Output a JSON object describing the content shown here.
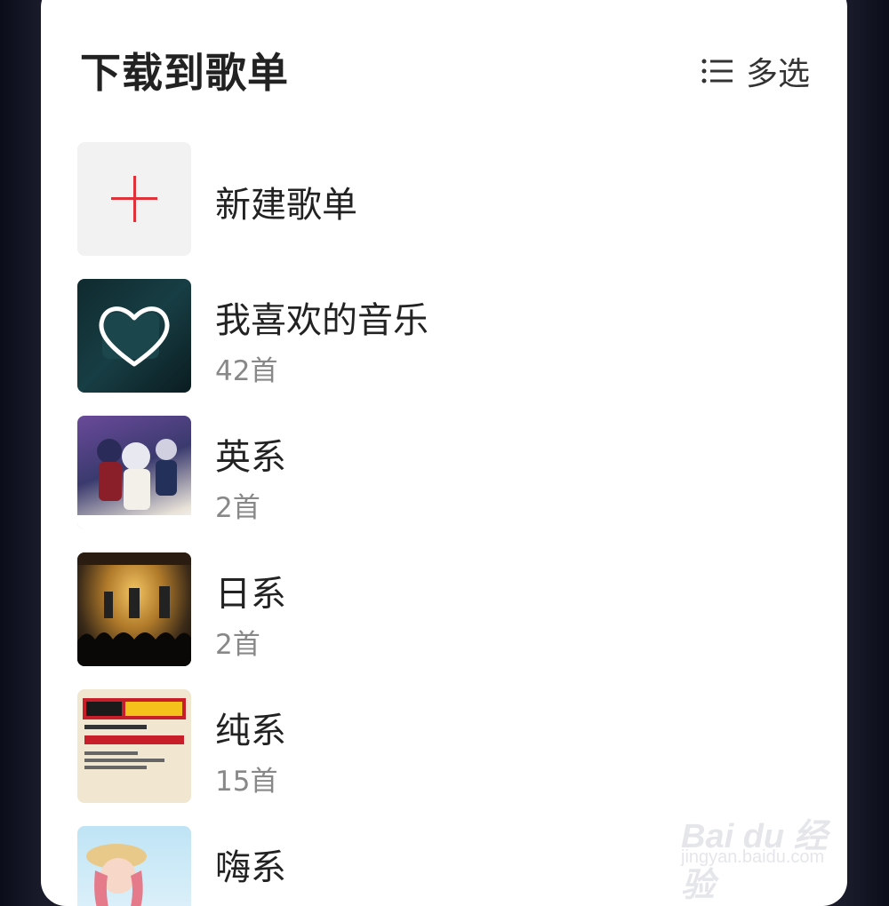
{
  "header": {
    "title": "下载到歌单",
    "multi_select_label": "多选",
    "multi_select_icon": "list-icon"
  },
  "new_playlist": {
    "label": "新建歌单",
    "icon": "plus-icon",
    "accent_color": "#e0303a"
  },
  "playlists": [
    {
      "name": "我喜欢的音乐",
      "count": "42首",
      "cover": "heart-cover"
    },
    {
      "name": "英系",
      "count": "2首",
      "cover": "anime-cover"
    },
    {
      "name": "日系",
      "count": "2首",
      "cover": "concert-cover"
    },
    {
      "name": "纯系",
      "count": "15首",
      "cover": "conan-cover"
    },
    {
      "name": "嗨系",
      "count": "",
      "cover": "anime-girl-cover"
    }
  ],
  "watermark": {
    "main": "Bai du 经验",
    "sub": "jingyan.baidu.com"
  }
}
